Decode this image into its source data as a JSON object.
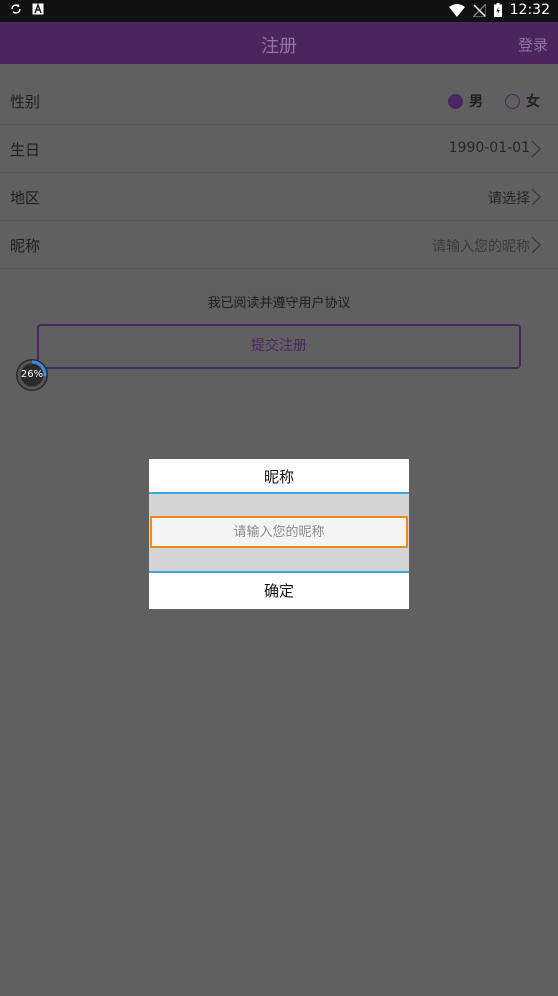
{
  "status_bar": {
    "time": "12:32"
  },
  "app_bar": {
    "title": "注册",
    "login": "登录"
  },
  "form": {
    "gender": {
      "label": "性别",
      "male": "男",
      "female": "女",
      "selected": "male"
    },
    "birthday": {
      "label": "生日",
      "value": "1990-01-01"
    },
    "region": {
      "label": "地区",
      "value": "请选择"
    },
    "nickname": {
      "label": "昵称",
      "placeholder": "请输入您的昵称"
    }
  },
  "agreement": "我已阅读并遵守用户协议",
  "submit_label": "提交注册",
  "progress": {
    "label": "26%",
    "value": 0.26
  },
  "dialog": {
    "title": "昵称",
    "input_placeholder": "请输入您的昵称",
    "input_value": "",
    "confirm": "确定"
  },
  "colors": {
    "primary": "#4b2560",
    "scrim": "#606060",
    "focus_border": "#ee8a1a",
    "divider_accent": "#3aa8d8"
  }
}
